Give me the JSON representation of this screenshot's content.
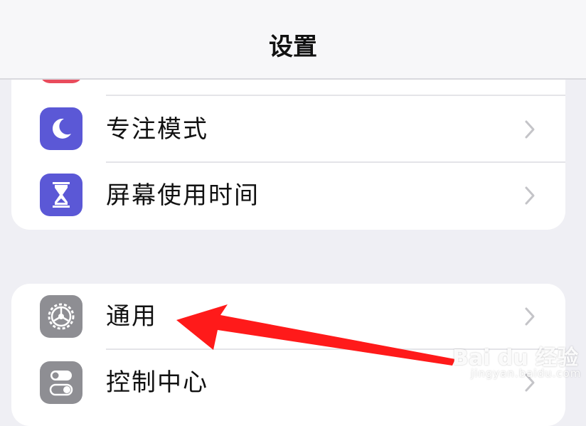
{
  "nav": {
    "title": "设置"
  },
  "group1": {
    "rows": [
      {
        "label": "",
        "icon": "notification-icon",
        "color": "#e94b5c"
      },
      {
        "label": "专注模式",
        "icon": "moon-icon",
        "color": "#5b58d6"
      },
      {
        "label": "屏幕使用时间",
        "icon": "hourglass-icon",
        "color": "#5b58d6"
      }
    ]
  },
  "group2": {
    "rows": [
      {
        "label": "通用",
        "icon": "gear-icon",
        "color": "#8e8e93"
      },
      {
        "label": "控制中心",
        "icon": "toggle-icon",
        "color": "#8e8e93"
      }
    ]
  },
  "annotation": {
    "arrow_color": "#ff1a1a"
  },
  "watermark": {
    "logo": "Bai du 经验",
    "url": "jingyan.baidu.com"
  }
}
